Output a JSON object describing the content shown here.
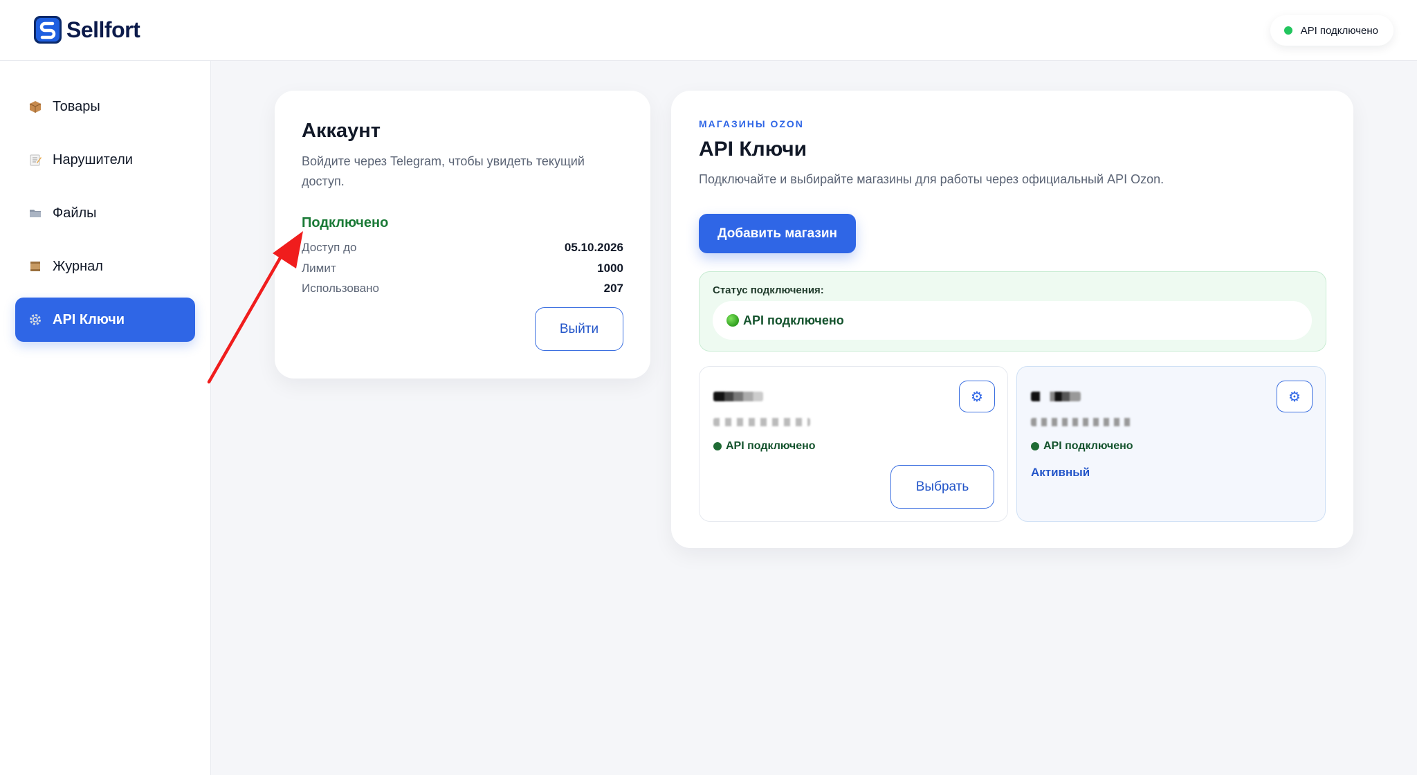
{
  "header": {
    "brand": "Sellfort",
    "api_status": "API подключено",
    "api_status_color": "#22c55e"
  },
  "sidebar": {
    "items": [
      {
        "label": "Товары",
        "icon": "package-icon",
        "active": false
      },
      {
        "label": "Нарушители",
        "icon": "memo-icon",
        "active": false
      },
      {
        "label": "Файлы",
        "icon": "folder-icon",
        "active": false
      },
      {
        "label": "Журнал",
        "icon": "scroll-icon",
        "active": false
      },
      {
        "label": "API Ключи",
        "icon": "gear-icon",
        "active": true
      }
    ],
    "active_color": "#2f66e6"
  },
  "account": {
    "title": "Аккаунт",
    "subtitle": "Войдите через Telegram, чтобы увидеть текущий доступ.",
    "status": "Подключено",
    "rows": [
      {
        "label": "Доступ до",
        "value": "05.10.2026"
      },
      {
        "label": "Лимит",
        "value": "1000"
      },
      {
        "label": "Использовано",
        "value": "207"
      }
    ],
    "logout_label": "Выйти"
  },
  "keys": {
    "eyebrow": "МАГАЗИНЫ OZON",
    "title": "API Ключи",
    "subtitle": "Подключайте и выбирайте магазины для работы через официальный API Ozon.",
    "add_label": "Добавить магазин",
    "connection": {
      "label": "Статус подключения:",
      "value": "API подключено"
    },
    "shops": [
      {
        "status": "API подключено",
        "action_label": "Выбрать",
        "active": false
      },
      {
        "status": "API подключено",
        "active_label": "Активный",
        "active": true
      }
    ]
  },
  "annotation": {
    "arrow_color": "#f01d1d"
  }
}
